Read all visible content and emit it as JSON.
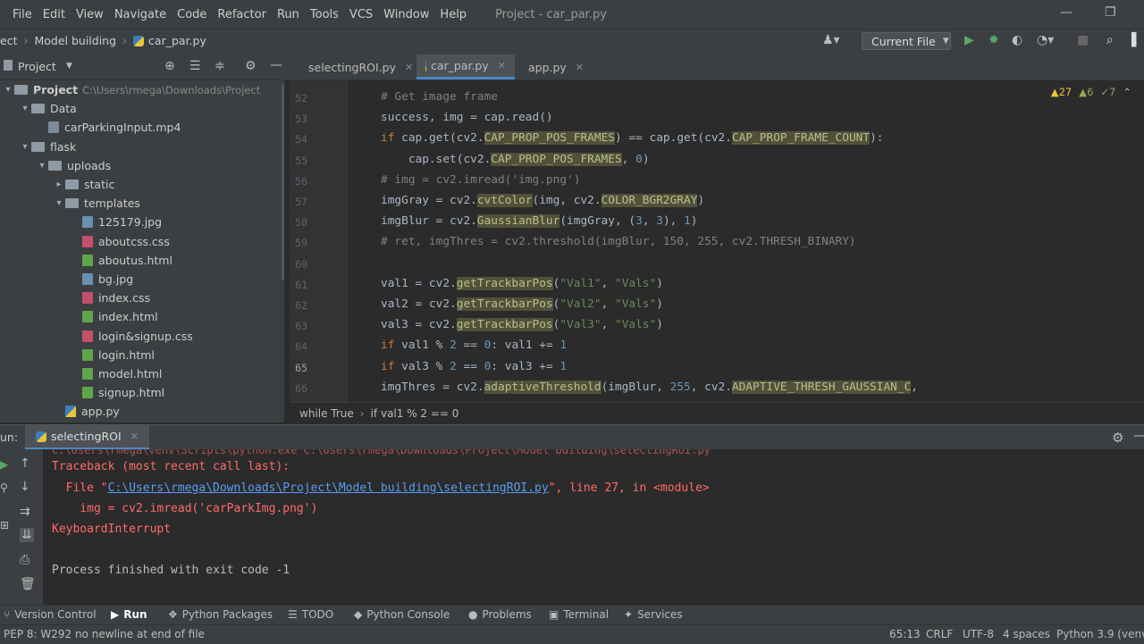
{
  "menu": {
    "items": [
      "File",
      "Edit",
      "View",
      "Navigate",
      "Code",
      "Refactor",
      "Run",
      "Tools",
      "VCS",
      "Window",
      "Help"
    ],
    "title": "Project - car_par.py"
  },
  "window_controls": {
    "minimize": "—",
    "restore": "❐"
  },
  "navbar": {
    "crumb0": "ect",
    "crumb1": "Model building",
    "crumb2": "car_par.py",
    "run_config": "Current File"
  },
  "project_panel": {
    "title": "Project"
  },
  "tabs": [
    {
      "label": "selectingROI.py",
      "active": false
    },
    {
      "label": "car_par.py",
      "active": true
    },
    {
      "label": "app.py",
      "active": false
    }
  ],
  "tree": [
    {
      "label": "Project",
      "path": "C:\\Users\\rmega\\Downloads\\Project",
      "type": "folder",
      "depth": 0,
      "arrow": "▾"
    },
    {
      "label": "Data",
      "type": "folder",
      "depth": 1,
      "arrow": "▾"
    },
    {
      "label": "carParkingInput.mp4",
      "type": "mp4",
      "depth": 2,
      "arrow": ""
    },
    {
      "label": "flask",
      "type": "folder",
      "depth": 1,
      "arrow": "▾"
    },
    {
      "label": "uploads",
      "type": "folder",
      "depth": 2,
      "arrow": "▾"
    },
    {
      "label": "static",
      "type": "folder",
      "depth": 3,
      "arrow": "▸"
    },
    {
      "label": "templates",
      "type": "folder",
      "depth": 3,
      "arrow": "▾"
    },
    {
      "label": "125179.jpg",
      "type": "jpg",
      "depth": 4,
      "arrow": ""
    },
    {
      "label": "aboutcss.css",
      "type": "css",
      "depth": 4,
      "arrow": ""
    },
    {
      "label": "aboutus.html",
      "type": "html",
      "depth": 4,
      "arrow": ""
    },
    {
      "label": "bg.jpg",
      "type": "jpg",
      "depth": 4,
      "arrow": ""
    },
    {
      "label": "index.css",
      "type": "css",
      "depth": 4,
      "arrow": ""
    },
    {
      "label": "index.html",
      "type": "html",
      "depth": 4,
      "arrow": ""
    },
    {
      "label": "login&signup.css",
      "type": "css",
      "depth": 4,
      "arrow": ""
    },
    {
      "label": "login.html",
      "type": "html",
      "depth": 4,
      "arrow": ""
    },
    {
      "label": "model.html",
      "type": "html",
      "depth": 4,
      "arrow": ""
    },
    {
      "label": "signup.html",
      "type": "html",
      "depth": 4,
      "arrow": ""
    },
    {
      "label": "app.py",
      "type": "py",
      "depth": 3,
      "arrow": ""
    }
  ],
  "inspections": {
    "warnings": "▲27",
    "weak": "▲6",
    "typos": "✓7"
  },
  "editor_lines": [
    {
      "n": "52",
      "html": "<span class=\"cm\"># Get image frame</span>"
    },
    {
      "n": "53",
      "html": "success, img = cap.read()"
    },
    {
      "n": "54",
      "html": "<span class=\"kw\">if</span> cap.get(cv2.<span class=\"hl\">CAP_PROP_POS_FRAMES</span>) == cap.get(cv2.<span class=\"hl\">CAP_PROP_FRAME_COUNT</span>):"
    },
    {
      "n": "55",
      "html": "    cap.set(cv2.<span class=\"hl\">CAP_PROP_POS_FRAMES</span>, <span class=\"nm\">0</span>)"
    },
    {
      "n": "56",
      "html": "<span class=\"cm\"># img = cv2.imread('img.png')</span>"
    },
    {
      "n": "57",
      "html": "imgGray = cv2.<span class=\"hl\">cvtColor</span>(img, cv2.<span class=\"hl\">COLOR_BGR2GRAY</span>)"
    },
    {
      "n": "58",
      "html": "imgBlur = cv2.<span class=\"hl\">GaussianBlur</span>(imgGray, (<span class=\"nm\">3</span>, <span class=\"nm\">3</span>), <span class=\"nm\">1</span>)"
    },
    {
      "n": "59",
      "html": "<span class=\"cm\"># ret, imgThres = cv2.threshold(imgBlur, 150, 255, cv2.THRESH_BINARY)</span>"
    },
    {
      "n": "60",
      "html": ""
    },
    {
      "n": "61",
      "html": "val1 = cv2.<span class=\"hl\">getTrackbarPos</span>(<span class=\"st\">\"Val1\"</span>, <span class=\"st\">\"Vals\"</span>)"
    },
    {
      "n": "62",
      "html": "val2 = cv2.<span class=\"hl\">getTrackbarPos</span>(<span class=\"st\">\"Val2\"</span>, <span class=\"st\">\"Vals\"</span>)"
    },
    {
      "n": "63",
      "html": "val3 = cv2.<span class=\"hl\">getTrackbarPos</span>(<span class=\"st\">\"Val3\"</span>, <span class=\"st\">\"Vals\"</span>)"
    },
    {
      "n": "64",
      "html": "<span class=\"kw\">if</span> val1 % <span class=\"nm\">2</span> == <span class=\"nm\">0</span>: val1 += <span class=\"nm\">1</span>"
    },
    {
      "n": "65",
      "html": "<span class=\"kw\">if</span> val3 % <span class=\"nm\">2</span> == <span class=\"nm\">0</span>: val3 += <span class=\"nm\">1</span>"
    },
    {
      "n": "66",
      "html": "imgThres = cv2.<span class=\"hl\">adaptiveThreshold</span>(imgBlur, <span class=\"nm\">255</span>, cv2.<span class=\"hl\">ADAPTIVE_THRESH_GAUSSIAN_C</span>,"
    }
  ],
  "breadcrumb": {
    "a": "while True",
    "b": "if val1 % 2 == 0"
  },
  "run_panel": {
    "label": "un:",
    "tab": "selectingROI"
  },
  "console": {
    "l1": "Traceback (most recent call last):",
    "l2a": "  File \"",
    "l2link": "C:\\Users\\rmega\\Downloads\\Project\\Model building\\selectingROI.py",
    "l2b": "\", line 27, in <module>",
    "l3": "    img = cv2.imread('carParkImg.png')",
    "l4": "KeyboardInterrupt",
    "l5": "Process finished with exit code -1"
  },
  "tooltabs": [
    {
      "label": "Version Control",
      "icon": "⑂"
    },
    {
      "label": "Run",
      "icon": "▶"
    },
    {
      "label": "Python Packages",
      "icon": "❖"
    },
    {
      "label": "TODO",
      "icon": "☰"
    },
    {
      "label": "Python Console",
      "icon": "◆"
    },
    {
      "label": "Problems",
      "icon": "●"
    },
    {
      "label": "Terminal",
      "icon": "▣"
    },
    {
      "label": "Services",
      "icon": "✦"
    }
  ],
  "status": {
    "message": "PEP 8: W292 no newline at end of file",
    "position": "65:13",
    "line_sep": "CRLF",
    "encoding": "UTF-8",
    "indent": "4 spaces",
    "interpreter": "Python 3.9 (venv)"
  }
}
